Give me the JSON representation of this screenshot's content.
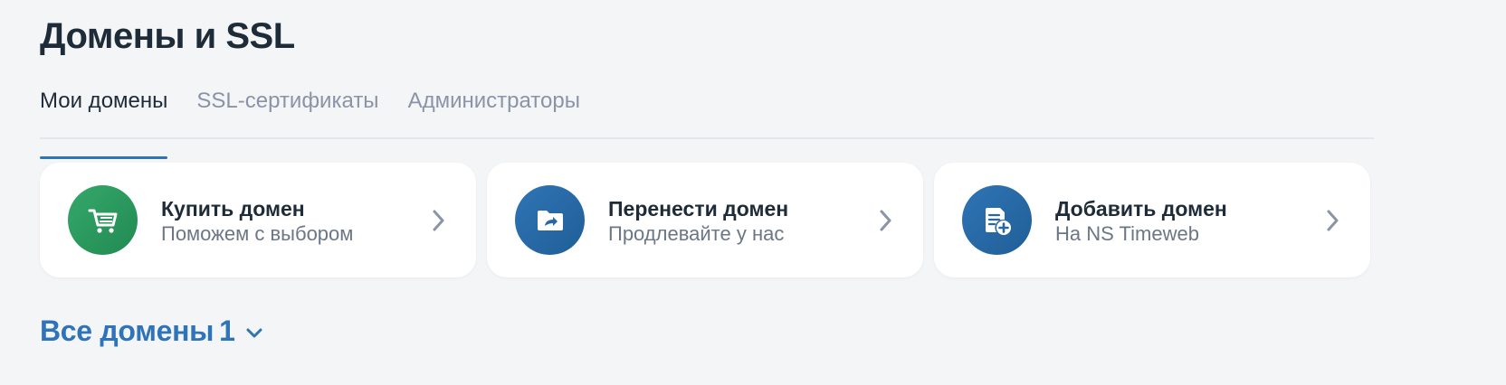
{
  "page_title": "Домены и SSL",
  "tabs": [
    {
      "label": "Мои домены",
      "active": true
    },
    {
      "label": "SSL-сертификаты",
      "active": false
    },
    {
      "label": "Администраторы",
      "active": false
    }
  ],
  "cards": [
    {
      "title": "Купить домен",
      "subtitle": "Поможем с выбором",
      "icon": "cart-icon",
      "icon_color": "#2a9a5e"
    },
    {
      "title": "Перенести домен",
      "subtitle": "Продлевайте у нас",
      "icon": "folder-share-icon",
      "icon_color": "#2767a6"
    },
    {
      "title": "Добавить домен",
      "subtitle": "На NS Timeweb",
      "icon": "document-add-icon",
      "icon_color": "#2767a6"
    }
  ],
  "all_domains": {
    "label": "Все домены",
    "count": "1"
  },
  "colors": {
    "accent": "#2f73b8",
    "background": "#f4f5f7",
    "card": "#ffffff",
    "text_primary": "#1e2b38",
    "text_secondary": "#6b7686",
    "tab_inactive": "#8a94a6"
  }
}
